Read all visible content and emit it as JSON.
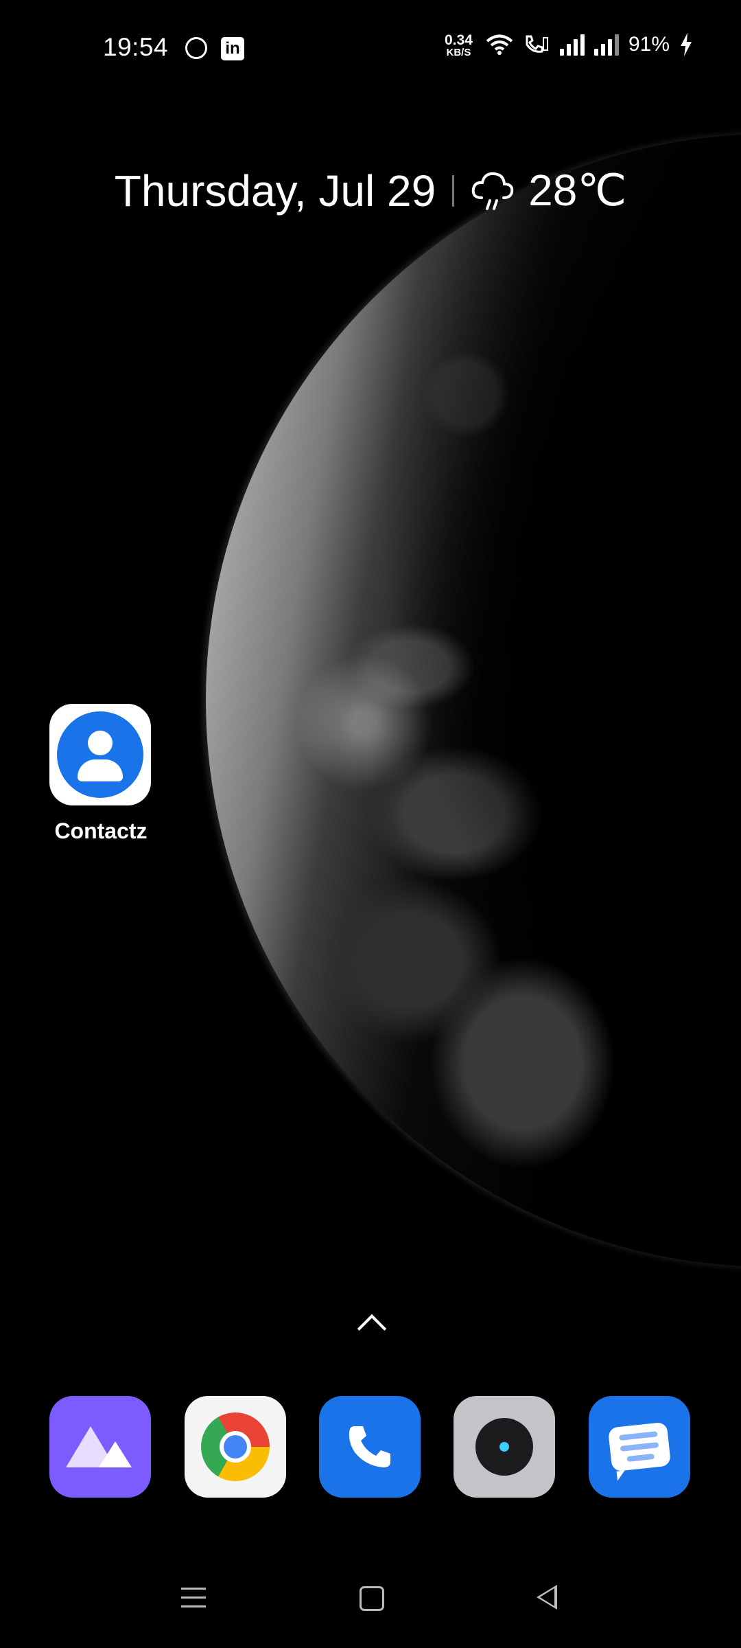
{
  "status_bar": {
    "time": "19:54",
    "notification_apps": [
      "whatsapp-icon",
      "linkedin-icon"
    ],
    "linkedin_glyph": "in",
    "net_speed_value": "0.34",
    "net_speed_unit": "KB/S",
    "battery_percent": "91%",
    "charging": true
  },
  "widget": {
    "date": "Thursday, Jul 29",
    "weather_icon": "cloud-rain-icon",
    "temperature": "28℃"
  },
  "home_apps": [
    {
      "label": "Contactz",
      "icon": "contacts-icon"
    }
  ],
  "dock": [
    {
      "icon": "gallery-icon"
    },
    {
      "icon": "chrome-icon"
    },
    {
      "icon": "phone-icon"
    },
    {
      "icon": "camera-icon"
    },
    {
      "icon": "messages-icon"
    }
  ],
  "colors": {
    "contacts_blue": "#1a73e8",
    "gallery_purple": "#7c5cff",
    "camera_gray": "#c2c4c8"
  }
}
